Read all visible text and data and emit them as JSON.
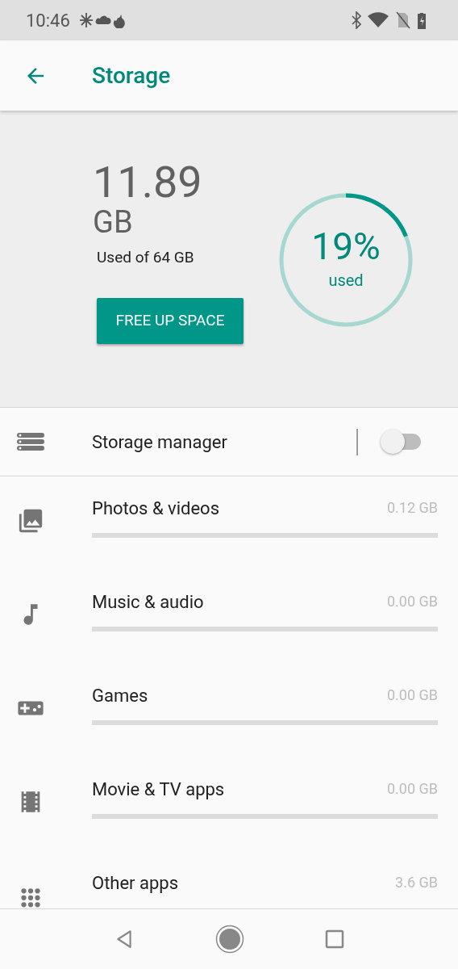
{
  "status_bar": {
    "time": "10:46"
  },
  "app_bar": {
    "title": "Storage"
  },
  "summary": {
    "amount": "11.89",
    "unit": "GB",
    "caption": "Used of 64 GB",
    "percent": "19%",
    "percent_label": "used",
    "button": "FREE UP SPACE"
  },
  "items": [
    {
      "kind": "toggle",
      "label": "Storage manager",
      "on": false
    },
    {
      "kind": "category",
      "label": "Photos & videos",
      "size": "0.12 GB",
      "level": 0
    },
    {
      "kind": "category",
      "label": "Music & audio",
      "size": "0.00 GB",
      "level": 0
    },
    {
      "kind": "category",
      "label": "Games",
      "size": "0.00 GB",
      "level": 0
    },
    {
      "kind": "category",
      "label": "Movie & TV apps",
      "size": "0.00 GB",
      "level": 0
    },
    {
      "kind": "partial",
      "label": "Other apps",
      "size": "3.6 GB"
    }
  ]
}
